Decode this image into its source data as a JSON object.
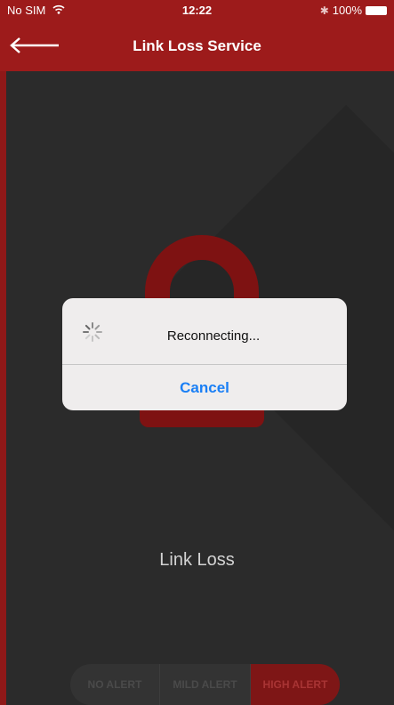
{
  "status_bar": {
    "carrier": "No SIM",
    "time": "12:22",
    "battery": "100%"
  },
  "navbar": {
    "title": "Link Loss Service",
    "back_icon": "arrow-left-icon"
  },
  "main": {
    "label": "Link Loss",
    "lock_icon": "padlock-icon"
  },
  "alert_levels": [
    {
      "label": "NO ALERT",
      "selected": false
    },
    {
      "label": "MILD ALERT",
      "selected": false
    },
    {
      "label": "HIGH ALERT",
      "selected": true
    }
  ],
  "dialog": {
    "message": "Reconnecting...",
    "cancel_label": "Cancel",
    "spinner_icon": "activity-spinner-icon"
  },
  "colors": {
    "accent": "#9d1b1b",
    "background": "#2b2b2b",
    "dialog_button": "#1a7ff5"
  }
}
